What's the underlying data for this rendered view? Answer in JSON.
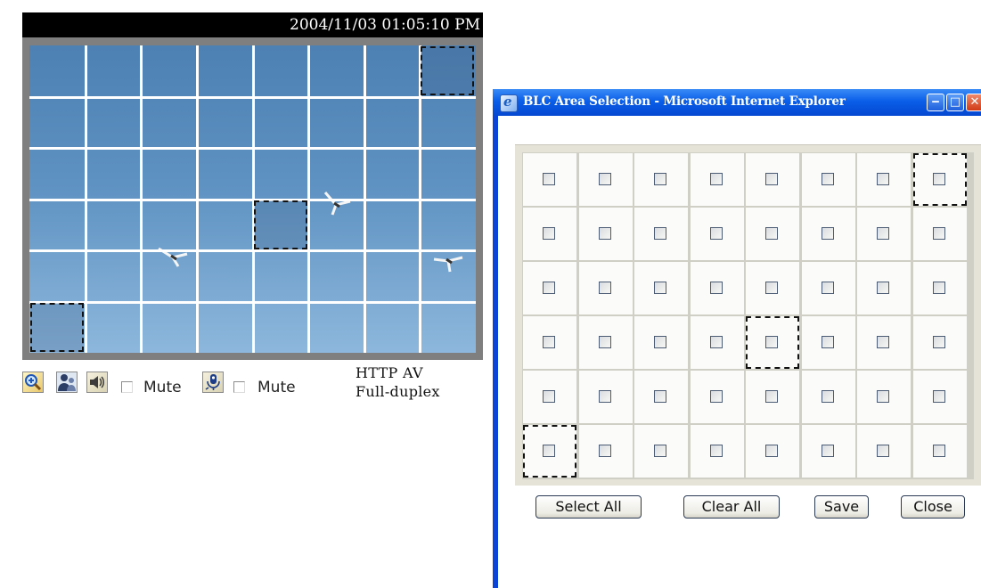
{
  "viewer": {
    "timestamp": "2004/11/03 01:05:10 PM",
    "toolbar": {
      "zoom_icon": "zoom-in-magnifier-icon",
      "talk_icon": "people-icon",
      "speaker_icon": "speaker-icon",
      "speaker_mute_label": "Mute",
      "speaker_mute_checked": false,
      "mic_icon": "microphone-icon",
      "mic_mute_label": "Mute",
      "mic_mute_checked": false
    },
    "protocol_line1": "HTTP  AV",
    "protocol_line2": "Full-duplex",
    "grid": {
      "rows": 6,
      "cols": 8
    },
    "selected_cells": [
      [
        0,
        7
      ],
      [
        3,
        4
      ],
      [
        5,
        0
      ]
    ]
  },
  "popup": {
    "title": "BLC Area Selection - Microsoft Internet Explorer",
    "window_buttons": {
      "minimize": "minimize-icon",
      "maximize": "maximize-icon",
      "close": "close-icon"
    },
    "grid": {
      "rows": 6,
      "cols": 8
    },
    "selected_cells": [
      [
        0,
        7
      ],
      [
        3,
        4
      ],
      [
        5,
        0
      ]
    ],
    "buttons": {
      "select_all": "Select All",
      "clear_all": "Clear All",
      "save": "Save",
      "close": "Close"
    }
  }
}
